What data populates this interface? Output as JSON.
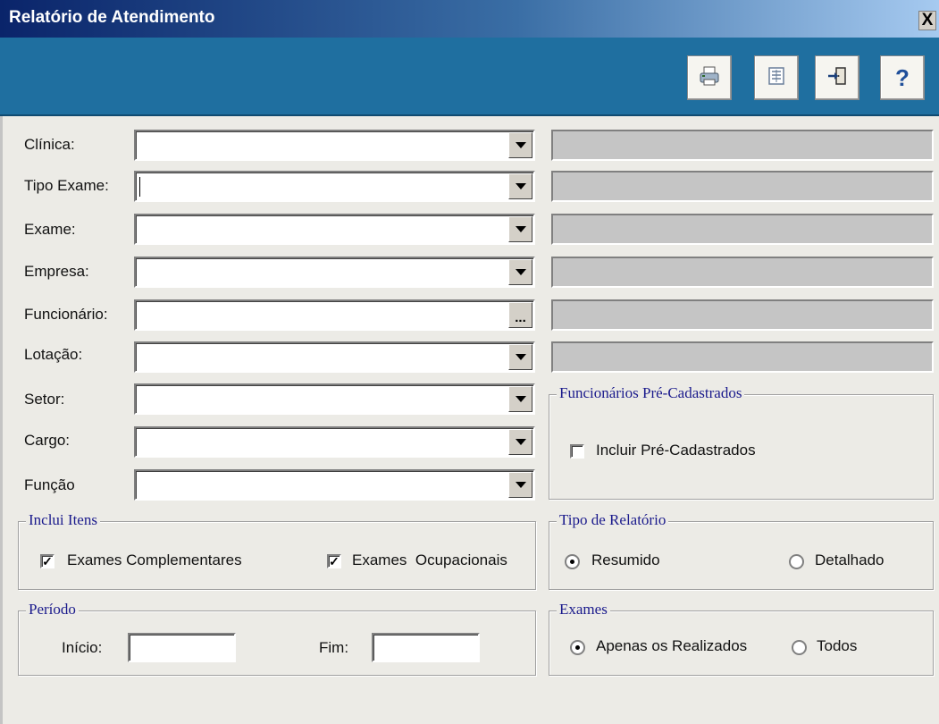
{
  "window": {
    "title": "Relatório de Atendimento",
    "close_label": "X"
  },
  "toolbar": {
    "buttons": [
      {
        "name": "print",
        "icon": "printer-icon"
      },
      {
        "name": "preview",
        "icon": "report-preview-icon"
      },
      {
        "name": "exit",
        "icon": "exit-door-icon"
      },
      {
        "name": "help",
        "icon": "help-icon",
        "label": "?"
      }
    ]
  },
  "form": {
    "fields": [
      {
        "label": "Clínica:",
        "value": "",
        "button": "dropdown"
      },
      {
        "label": "Tipo Exame:",
        "value": "",
        "button": "dropdown"
      },
      {
        "label": "Exame:",
        "value": "",
        "button": "dropdown"
      },
      {
        "label": "Empresa:",
        "value": "",
        "button": "dropdown"
      },
      {
        "label": "Funcionário:",
        "value": "",
        "button": "ellipsis",
        "button_label": "..."
      },
      {
        "label": "Lotação:",
        "value": "",
        "button": "dropdown"
      },
      {
        "label": "Setor:",
        "value": "",
        "button": "dropdown"
      },
      {
        "label": "Cargo:",
        "value": "",
        "button": "dropdown"
      },
      {
        "label": "Função",
        "value": "",
        "button": "dropdown"
      }
    ]
  },
  "pre_cadastrados": {
    "title": "Funcionários Pré-Cadastrados",
    "checkbox_label": "Incluir Pré-Cadastrados",
    "checked": false
  },
  "inclui_itens": {
    "title": "Inclui Itens",
    "items": [
      {
        "label": "Exames Complementares",
        "checked": true
      },
      {
        "label": "Exames  Ocupacionais",
        "checked": true
      }
    ]
  },
  "tipo_relatorio": {
    "title": "Tipo de Relatório",
    "options": [
      {
        "label": "Resumido",
        "selected": true
      },
      {
        "label": "Detalhado",
        "selected": false
      }
    ]
  },
  "periodo": {
    "title": "Período",
    "inicio_label": "Início:",
    "fim_label": "Fim:",
    "inicio_value": "",
    "fim_value": ""
  },
  "exames": {
    "title": "Exames",
    "options": [
      {
        "label": "Apenas os Realizados",
        "selected": true
      },
      {
        "label": "Todos",
        "selected": false
      }
    ]
  },
  "colors": {
    "toolbar_bg": "#1f6fa0",
    "title_gradient_start": "#0a246a",
    "group_title": "#1a1a8c",
    "window_bg": "#ecebe6",
    "desc_field_bg": "#c5c5c5"
  }
}
